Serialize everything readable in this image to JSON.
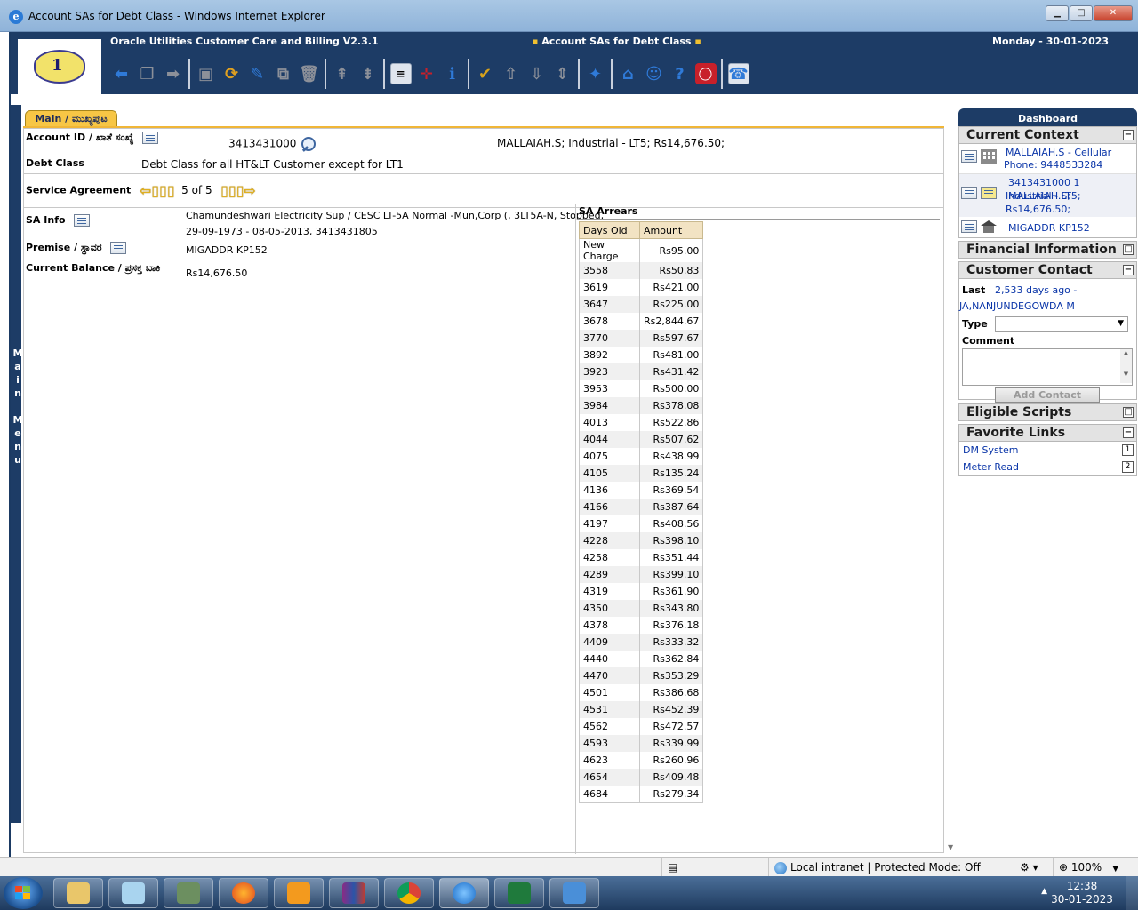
{
  "window": {
    "title": "Account SAs for Debt Class - Windows Internet Explorer",
    "min_label": "▁",
    "max_label": "□",
    "close_label": "✕"
  },
  "header": {
    "app_name": "Oracle Utilities Customer Care and Billing V2.3.1",
    "page_title": "Account SAs for Debt Class",
    "date": "Monday - 30-01-2023"
  },
  "left_menu": {
    "label_chars": [
      "M",
      "a",
      "i",
      "n",
      "",
      "M",
      "e",
      "n",
      "u"
    ]
  },
  "tab": {
    "label": "Main / ಮುಖ್ಯಪುಟ"
  },
  "account": {
    "label": "Account ID / ಖಾತೆ ಸಂಖ್ಯೆ",
    "id": "3413431000",
    "summary": "MALLAIAH.S; Industrial - LT5; Rs14,676.50;"
  },
  "debt_class": {
    "label": "Debt Class",
    "value": "Debt Class for all HT&LT Customer except for LT1"
  },
  "service_agreement": {
    "label": "Service Agreement",
    "position": "5 of 5"
  },
  "sa_info": {
    "label": "SA Info",
    "line1": "Chamundeshwari Electricity Sup / CESC LT-5A  Normal -Mun,Corp (, 3LT5A-N, Stopped,",
    "line2": "29-09-1973 - 08-05-2013, 3413431805"
  },
  "premise": {
    "label": "Premise / ಸ್ಥಾವರ",
    "value": "MIGADDR KP152"
  },
  "balance": {
    "label": "Current Balance / ಪ್ರಸಕ್ತ ಬಾಕಿ",
    "value": "Rs14,676.50"
  },
  "sa_arrears": {
    "title": "SA Arrears",
    "columns": [
      "Days Old",
      "Amount"
    ],
    "rows": [
      [
        "New Charge",
        "Rs95.00"
      ],
      [
        "3558",
        "Rs50.83"
      ],
      [
        "3619",
        "Rs421.00"
      ],
      [
        "3647",
        "Rs225.00"
      ],
      [
        "3678",
        "Rs2,844.67"
      ],
      [
        "3770",
        "Rs597.67"
      ],
      [
        "3892",
        "Rs481.00"
      ],
      [
        "3923",
        "Rs431.42"
      ],
      [
        "3953",
        "Rs500.00"
      ],
      [
        "3984",
        "Rs378.08"
      ],
      [
        "4013",
        "Rs522.86"
      ],
      [
        "4044",
        "Rs507.62"
      ],
      [
        "4075",
        "Rs438.99"
      ],
      [
        "4105",
        "Rs135.24"
      ],
      [
        "4136",
        "Rs369.54"
      ],
      [
        "4166",
        "Rs387.64"
      ],
      [
        "4197",
        "Rs408.56"
      ],
      [
        "4228",
        "Rs398.10"
      ],
      [
        "4258",
        "Rs351.44"
      ],
      [
        "4289",
        "Rs399.10"
      ],
      [
        "4319",
        "Rs361.90"
      ],
      [
        "4350",
        "Rs343.80"
      ],
      [
        "4378",
        "Rs376.18"
      ],
      [
        "4409",
        "Rs333.32"
      ],
      [
        "4440",
        "Rs362.84"
      ],
      [
        "4470",
        "Rs353.29"
      ],
      [
        "4501",
        "Rs386.68"
      ],
      [
        "4531",
        "Rs452.39"
      ],
      [
        "4562",
        "Rs472.57"
      ],
      [
        "4593",
        "Rs339.99"
      ],
      [
        "4623",
        "Rs260.96"
      ],
      [
        "4654",
        "Rs409.48"
      ],
      [
        "4684",
        "Rs279.34"
      ]
    ]
  },
  "dashboard": {
    "title": "Dashboard",
    "current_context": {
      "title": "Current Context",
      "person_line1": "MALLAIAH.S - Cellular",
      "person_line2": "Phone: 9448533284",
      "account_line1": "3413431000 1 MALLAIAH.S;",
      "account_line2": "Industrial - LT5;",
      "account_line3": "Rs14,676.50;",
      "premise": "MIGADDR KP152"
    },
    "financial_information": {
      "title": "Financial Information"
    },
    "customer_contact": {
      "title": "Customer Contact",
      "last_label": "Last",
      "last_value": "2,533 days ago -",
      "last_person": "JA,NANJUNDEGOWDA M",
      "type_label": "Type",
      "comment_label": "Comment",
      "add_button": "Add Contact"
    },
    "eligible_scripts": {
      "title": "Eligible Scripts"
    },
    "favorite_links": {
      "title": "Favorite Links",
      "items": [
        {
          "label": "DM System",
          "key": "1"
        },
        {
          "label": "Meter Read",
          "key": "2"
        }
      ]
    }
  },
  "statusbar": {
    "zone": "Local intranet | Protected Mode: Off",
    "zoom": "100%"
  },
  "taskbar": {
    "time": "12:38",
    "date": "30-01-2023"
  }
}
